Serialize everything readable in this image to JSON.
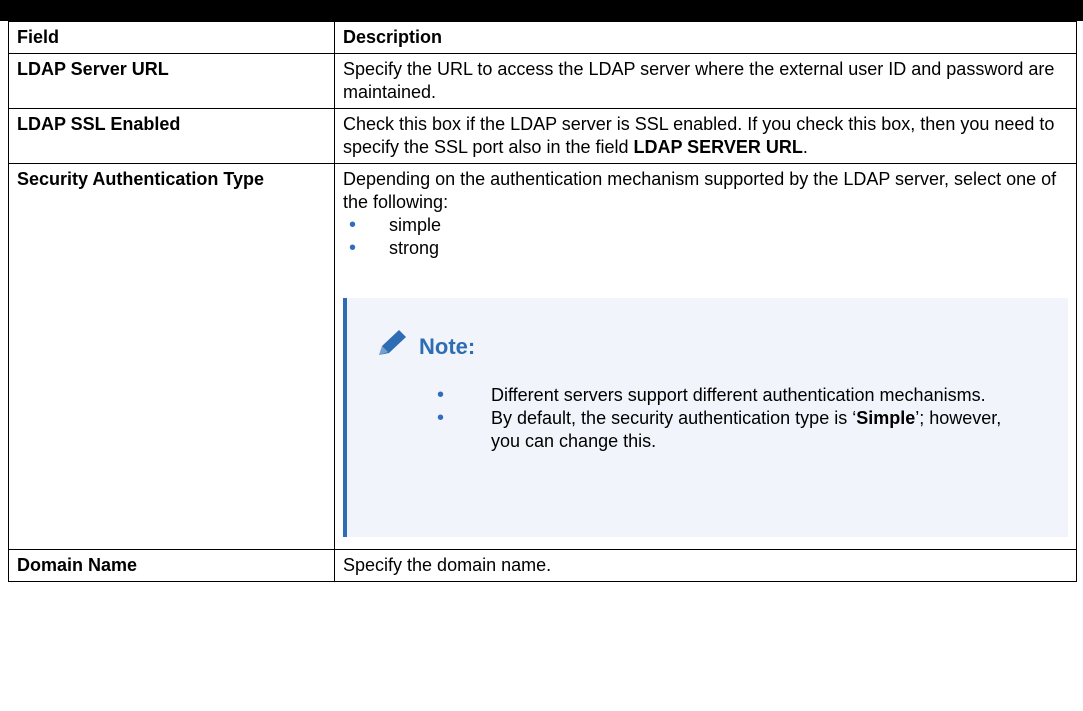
{
  "table": {
    "headers": {
      "field": "Field",
      "description": "Description"
    },
    "rows": [
      {
        "field": "LDAP Server URL",
        "description": "Specify the URL to access the LDAP server where the external user ID and password are maintained."
      },
      {
        "field": "LDAP SSL Enabled",
        "description_pre": "Check this box if the LDAP server is SSL enabled. If you check this box, then you need to specify the SSL port also in the field ",
        "description_bold": "LDAP SERVER URL",
        "description_post": "."
      },
      {
        "field": "Security Authentication Type",
        "description": "Depending on the authentication mechanism supported by the LDAP server, select one of the following:",
        "options": [
          "simple",
          "strong"
        ],
        "note": {
          "icon": "pencil-icon",
          "title": "Note:",
          "items": [
            {
              "text": "Different servers support different authentication mechanisms."
            },
            {
              "pre": "By default, the security authentication type is ‘",
              "bold": "Simple",
              "post": "’; however, you can change this."
            }
          ]
        }
      },
      {
        "field": "Domain Name",
        "description": "Specify the domain name."
      }
    ]
  },
  "colors": {
    "accent": "#2e6db4",
    "note_bg": "#f1f5fb",
    "bullet": "#2f6ebd"
  }
}
